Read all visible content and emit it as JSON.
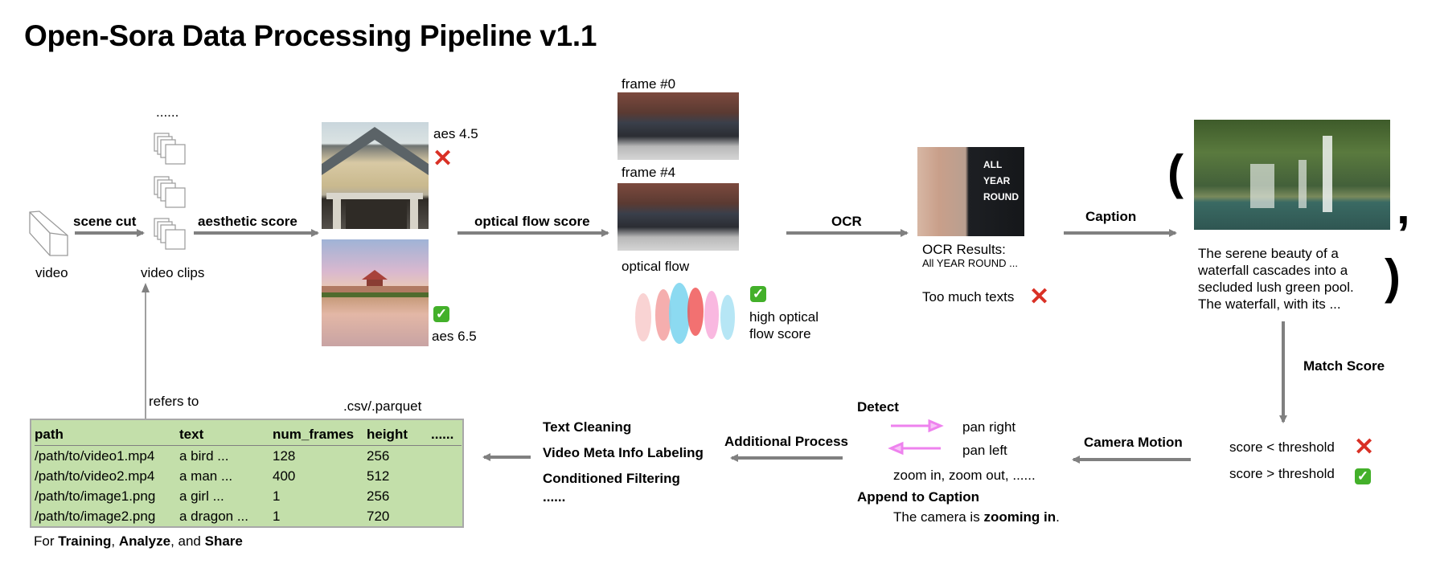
{
  "title": "Open-Sora Data Processing Pipeline v1.1",
  "stage_scene_cut": {
    "video_label": "video",
    "arrow_label": "scene cut",
    "clips_label": "video clips",
    "clips_ellipsis": "......",
    "refers_to": "refers to"
  },
  "stage_aesthetic": {
    "arrow_label": "aesthetic score",
    "low_score_label": "aes 4.5",
    "high_score_label": "aes 6.5",
    "low_image": "house-photo",
    "high_image": "pagoda-reflection-photo",
    "low_status": "rejected",
    "high_status": "accepted"
  },
  "stage_optical_flow": {
    "arrow_label": "optical flow score",
    "frame0_label": "frame #0",
    "frame4_label": "frame #4",
    "flow_label": "optical flow",
    "result_line1": "high optical",
    "result_line2": "flow score",
    "status": "accepted"
  },
  "stage_ocr": {
    "arrow_label": "OCR",
    "results_title": "OCR Results:",
    "results_text": "All YEAR ROUND ...",
    "verdict": "Too much texts",
    "status": "rejected",
    "image_text_line1": "ALL YEAR",
    "image_text_line2": "ROUND"
  },
  "stage_caption": {
    "arrow_label": "Caption",
    "open_paren": "(",
    "comma": ",",
    "close_paren": ")",
    "caption_text": "The serene beauty of a waterfall cascades into a secluded lush green pool. The waterfall, with its ..."
  },
  "stage_match": {
    "arrow_label": "Match Score",
    "below_label": "score < threshold",
    "above_label": "score > threshold",
    "below_status": "rejected",
    "above_status": "accepted"
  },
  "stage_camera": {
    "arrow_label": "Camera Motion",
    "detect_title": "Detect",
    "pan_right": "pan right",
    "pan_left": "pan left",
    "others": "zoom in, zoom out, ......",
    "append_title": "Append to Caption",
    "append_prefix": "The camera is ",
    "append_bold": "zooming in",
    "append_suffix": ".",
    "pan_arrow_color": "#ee82ee"
  },
  "stage_additional": {
    "arrow_label": "Additional Process",
    "items": [
      "Text Cleaning",
      "Video Meta Info Labeling",
      "Conditioned Filtering",
      "......"
    ]
  },
  "output_table": {
    "format_label": ".csv/.parquet",
    "background_color": "#c3dfaa",
    "columns": [
      "path",
      "text",
      "num_frames",
      "height",
      "......"
    ],
    "rows": [
      [
        "/path/to/video1.mp4",
        "a bird ...",
        "128",
        "256",
        ""
      ],
      [
        "/path/to/video2.mp4",
        "a man ...",
        "400",
        "512",
        ""
      ],
      [
        "/path/to/image1.png",
        "a girl ...",
        "1",
        "256",
        ""
      ],
      [
        "/path/to/image2.png",
        "a dragon ...",
        "1",
        "720",
        ""
      ]
    ],
    "footer_prefix": "For ",
    "footer_b1": "Training",
    "footer_sep1": ", ",
    "footer_b2": "Analyze",
    "footer_sep2": ", and ",
    "footer_b3": "Share"
  },
  "colors": {
    "arrow": "#808080",
    "reject": "#d93025",
    "accept": "#43b02a"
  }
}
